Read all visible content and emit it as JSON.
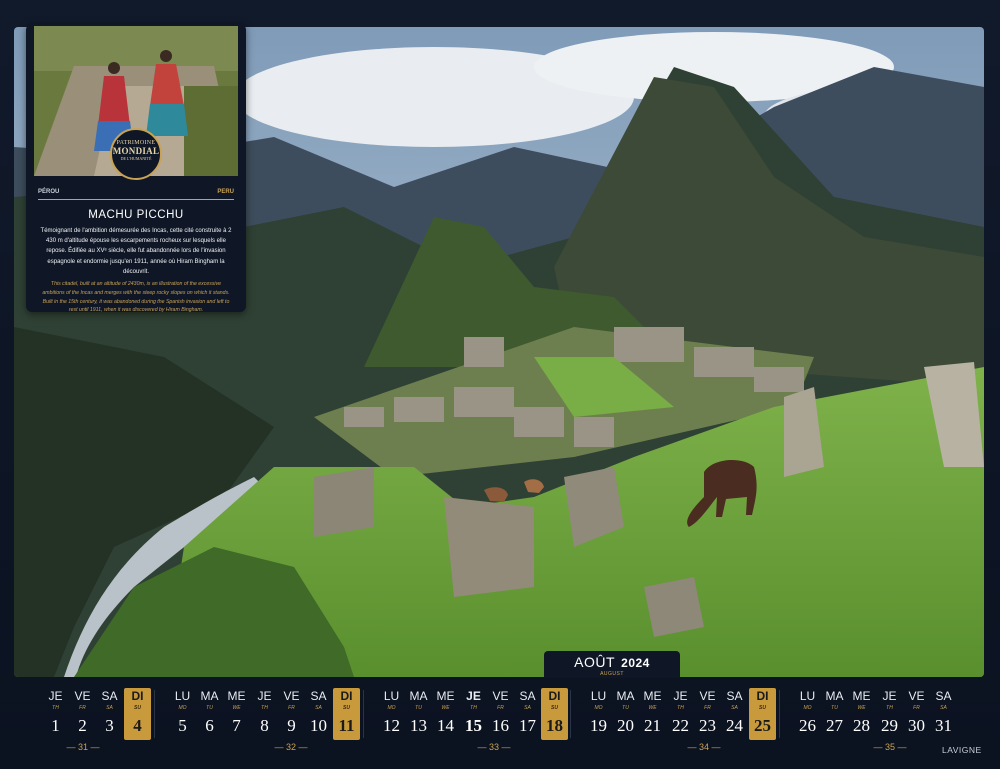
{
  "info_card": {
    "seal_top": "PATRIMOINE",
    "seal_main": "MONDIAL",
    "seal_bottom": "DE L'HUMANITÉ",
    "country_left": "PÉROU",
    "country_right": "PERU",
    "title": "MACHU PICCHU",
    "text_fr": "Témoignant de l'ambition démesurée des Incas, cette cité construite à 2 430 m d'altitude épouse les escarpements rocheux sur lesquels elle repose. Édifiée au XVᵉ siècle, elle fut abandonnée lors de l'invasion espagnole et endormie jusqu'en 1911, année où Hiram Bingham la découvrit.",
    "text_en": "This citadel, built at an altitude of 2430m, is an illustration of the excessive ambitions of the Incas and merges with the steep rocky slopes on which it stands. Built in the 15th century, it was abandoned during the Spanish invasion and left to rest until 1911, when it was discovered by Hiram Bingham."
  },
  "month": {
    "name": "AOÛT",
    "year": "2024",
    "name_en": "AUGUST"
  },
  "days": [
    {
      "abbr": "JE",
      "en": "TH",
      "num": "1"
    },
    {
      "abbr": "VE",
      "en": "FR",
      "num": "2"
    },
    {
      "abbr": "SA",
      "en": "SA",
      "num": "3"
    },
    {
      "abbr": "DI",
      "en": "SU",
      "num": "4",
      "sunday": true
    },
    {
      "abbr": "LU",
      "en": "MO",
      "num": "5"
    },
    {
      "abbr": "MA",
      "en": "TU",
      "num": "6"
    },
    {
      "abbr": "ME",
      "en": "WE",
      "num": "7"
    },
    {
      "abbr": "JE",
      "en": "TH",
      "num": "8"
    },
    {
      "abbr": "VE",
      "en": "FR",
      "num": "9"
    },
    {
      "abbr": "SA",
      "en": "SA",
      "num": "10"
    },
    {
      "abbr": "DI",
      "en": "SU",
      "num": "11",
      "sunday": true
    },
    {
      "abbr": "LU",
      "en": "MO",
      "num": "12"
    },
    {
      "abbr": "MA",
      "en": "TU",
      "num": "13"
    },
    {
      "abbr": "ME",
      "en": "WE",
      "num": "14"
    },
    {
      "abbr": "JE",
      "en": "TH",
      "num": "15",
      "holiday": true
    },
    {
      "abbr": "VE",
      "en": "FR",
      "num": "16"
    },
    {
      "abbr": "SA",
      "en": "SA",
      "num": "17"
    },
    {
      "abbr": "DI",
      "en": "SU",
      "num": "18",
      "sunday": true
    },
    {
      "abbr": "LU",
      "en": "MO",
      "num": "19"
    },
    {
      "abbr": "MA",
      "en": "TU",
      "num": "20"
    },
    {
      "abbr": "ME",
      "en": "WE",
      "num": "21"
    },
    {
      "abbr": "JE",
      "en": "TH",
      "num": "22"
    },
    {
      "abbr": "VE",
      "en": "FR",
      "num": "23"
    },
    {
      "abbr": "SA",
      "en": "SA",
      "num": "24"
    },
    {
      "abbr": "DI",
      "en": "SU",
      "num": "25",
      "sunday": true
    },
    {
      "abbr": "LU",
      "en": "MO",
      "num": "26"
    },
    {
      "abbr": "MA",
      "en": "TU",
      "num": "27"
    },
    {
      "abbr": "ME",
      "en": "WE",
      "num": "28"
    },
    {
      "abbr": "JE",
      "en": "TH",
      "num": "29"
    },
    {
      "abbr": "VE",
      "en": "FR",
      "num": "30"
    },
    {
      "abbr": "SA",
      "en": "SA",
      "num": "31"
    }
  ],
  "weeks": [
    "31",
    "32",
    "33",
    "34",
    "35"
  ],
  "brand": "LAVIGNE",
  "colors": {
    "accent": "#c99a3c",
    "background": "#0d1524"
  }
}
